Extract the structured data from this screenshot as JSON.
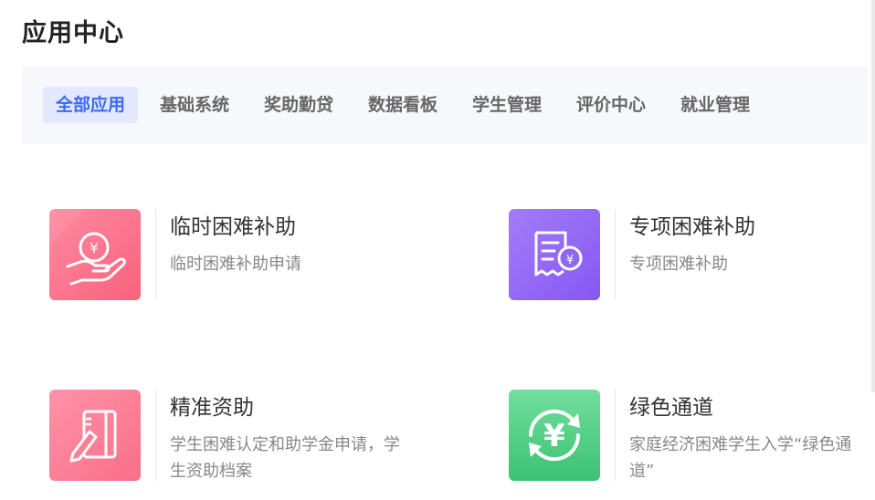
{
  "page": {
    "title": "应用中心"
  },
  "tabs": [
    {
      "label": "全部应用",
      "active": true
    },
    {
      "label": "基础系统"
    },
    {
      "label": "奖助勤贷"
    },
    {
      "label": "数据看板"
    },
    {
      "label": "学生管理"
    },
    {
      "label": "评价中心"
    },
    {
      "label": "就业管理"
    }
  ],
  "apps": [
    {
      "title": "临时困难补助",
      "desc": "临时困难补助申请",
      "icon": "coin-hand-icon",
      "color": "#fb6f87"
    },
    {
      "title": "专项困难补助",
      "desc": "专项困难补助",
      "icon": "receipt-yuan-icon",
      "color": "#8f67f5"
    },
    {
      "title": "精准资助",
      "desc": "学生困难认定和助学金申请，学生资助档案",
      "icon": "notebook-pen-icon",
      "color": "#fb7a93"
    },
    {
      "title": "绿色通道",
      "desc": "家庭经济困难学生入学“绿色通道”",
      "icon": "yuan-cycle-icon",
      "color": "#3fca7a"
    }
  ]
}
